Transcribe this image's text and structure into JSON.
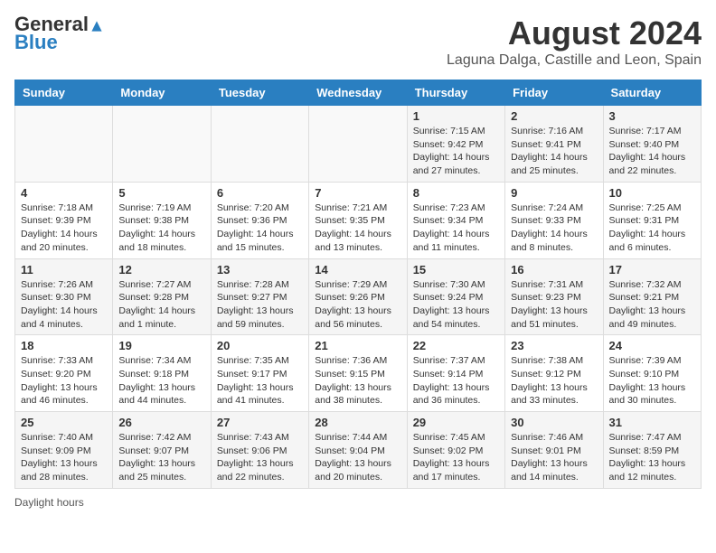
{
  "header": {
    "logo_general": "General",
    "logo_blue": "Blue",
    "month_year": "August 2024",
    "location": "Laguna Dalga, Castille and Leon, Spain"
  },
  "days_of_week": [
    "Sunday",
    "Monday",
    "Tuesday",
    "Wednesday",
    "Thursday",
    "Friday",
    "Saturday"
  ],
  "weeks": [
    [
      {
        "day": "",
        "info": ""
      },
      {
        "day": "",
        "info": ""
      },
      {
        "day": "",
        "info": ""
      },
      {
        "day": "",
        "info": ""
      },
      {
        "day": "1",
        "info": "Sunrise: 7:15 AM\nSunset: 9:42 PM\nDaylight: 14 hours\nand 27 minutes."
      },
      {
        "day": "2",
        "info": "Sunrise: 7:16 AM\nSunset: 9:41 PM\nDaylight: 14 hours\nand 25 minutes."
      },
      {
        "day": "3",
        "info": "Sunrise: 7:17 AM\nSunset: 9:40 PM\nDaylight: 14 hours\nand 22 minutes."
      }
    ],
    [
      {
        "day": "4",
        "info": "Sunrise: 7:18 AM\nSunset: 9:39 PM\nDaylight: 14 hours\nand 20 minutes."
      },
      {
        "day": "5",
        "info": "Sunrise: 7:19 AM\nSunset: 9:38 PM\nDaylight: 14 hours\nand 18 minutes."
      },
      {
        "day": "6",
        "info": "Sunrise: 7:20 AM\nSunset: 9:36 PM\nDaylight: 14 hours\nand 15 minutes."
      },
      {
        "day": "7",
        "info": "Sunrise: 7:21 AM\nSunset: 9:35 PM\nDaylight: 14 hours\nand 13 minutes."
      },
      {
        "day": "8",
        "info": "Sunrise: 7:23 AM\nSunset: 9:34 PM\nDaylight: 14 hours\nand 11 minutes."
      },
      {
        "day": "9",
        "info": "Sunrise: 7:24 AM\nSunset: 9:33 PM\nDaylight: 14 hours\nand 8 minutes."
      },
      {
        "day": "10",
        "info": "Sunrise: 7:25 AM\nSunset: 9:31 PM\nDaylight: 14 hours\nand 6 minutes."
      }
    ],
    [
      {
        "day": "11",
        "info": "Sunrise: 7:26 AM\nSunset: 9:30 PM\nDaylight: 14 hours\nand 4 minutes."
      },
      {
        "day": "12",
        "info": "Sunrise: 7:27 AM\nSunset: 9:28 PM\nDaylight: 14 hours\nand 1 minute."
      },
      {
        "day": "13",
        "info": "Sunrise: 7:28 AM\nSunset: 9:27 PM\nDaylight: 13 hours\nand 59 minutes."
      },
      {
        "day": "14",
        "info": "Sunrise: 7:29 AM\nSunset: 9:26 PM\nDaylight: 13 hours\nand 56 minutes."
      },
      {
        "day": "15",
        "info": "Sunrise: 7:30 AM\nSunset: 9:24 PM\nDaylight: 13 hours\nand 54 minutes."
      },
      {
        "day": "16",
        "info": "Sunrise: 7:31 AM\nSunset: 9:23 PM\nDaylight: 13 hours\nand 51 minutes."
      },
      {
        "day": "17",
        "info": "Sunrise: 7:32 AM\nSunset: 9:21 PM\nDaylight: 13 hours\nand 49 minutes."
      }
    ],
    [
      {
        "day": "18",
        "info": "Sunrise: 7:33 AM\nSunset: 9:20 PM\nDaylight: 13 hours\nand 46 minutes."
      },
      {
        "day": "19",
        "info": "Sunrise: 7:34 AM\nSunset: 9:18 PM\nDaylight: 13 hours\nand 44 minutes."
      },
      {
        "day": "20",
        "info": "Sunrise: 7:35 AM\nSunset: 9:17 PM\nDaylight: 13 hours\nand 41 minutes."
      },
      {
        "day": "21",
        "info": "Sunrise: 7:36 AM\nSunset: 9:15 PM\nDaylight: 13 hours\nand 38 minutes."
      },
      {
        "day": "22",
        "info": "Sunrise: 7:37 AM\nSunset: 9:14 PM\nDaylight: 13 hours\nand 36 minutes."
      },
      {
        "day": "23",
        "info": "Sunrise: 7:38 AM\nSunset: 9:12 PM\nDaylight: 13 hours\nand 33 minutes."
      },
      {
        "day": "24",
        "info": "Sunrise: 7:39 AM\nSunset: 9:10 PM\nDaylight: 13 hours\nand 30 minutes."
      }
    ],
    [
      {
        "day": "25",
        "info": "Sunrise: 7:40 AM\nSunset: 9:09 PM\nDaylight: 13 hours\nand 28 minutes."
      },
      {
        "day": "26",
        "info": "Sunrise: 7:42 AM\nSunset: 9:07 PM\nDaylight: 13 hours\nand 25 minutes."
      },
      {
        "day": "27",
        "info": "Sunrise: 7:43 AM\nSunset: 9:06 PM\nDaylight: 13 hours\nand 22 minutes."
      },
      {
        "day": "28",
        "info": "Sunrise: 7:44 AM\nSunset: 9:04 PM\nDaylight: 13 hours\nand 20 minutes."
      },
      {
        "day": "29",
        "info": "Sunrise: 7:45 AM\nSunset: 9:02 PM\nDaylight: 13 hours\nand 17 minutes."
      },
      {
        "day": "30",
        "info": "Sunrise: 7:46 AM\nSunset: 9:01 PM\nDaylight: 13 hours\nand 14 minutes."
      },
      {
        "day": "31",
        "info": "Sunrise: 7:47 AM\nSunset: 8:59 PM\nDaylight: 13 hours\nand 12 minutes."
      }
    ]
  ],
  "legend": {
    "daylight_hours": "Daylight hours"
  }
}
